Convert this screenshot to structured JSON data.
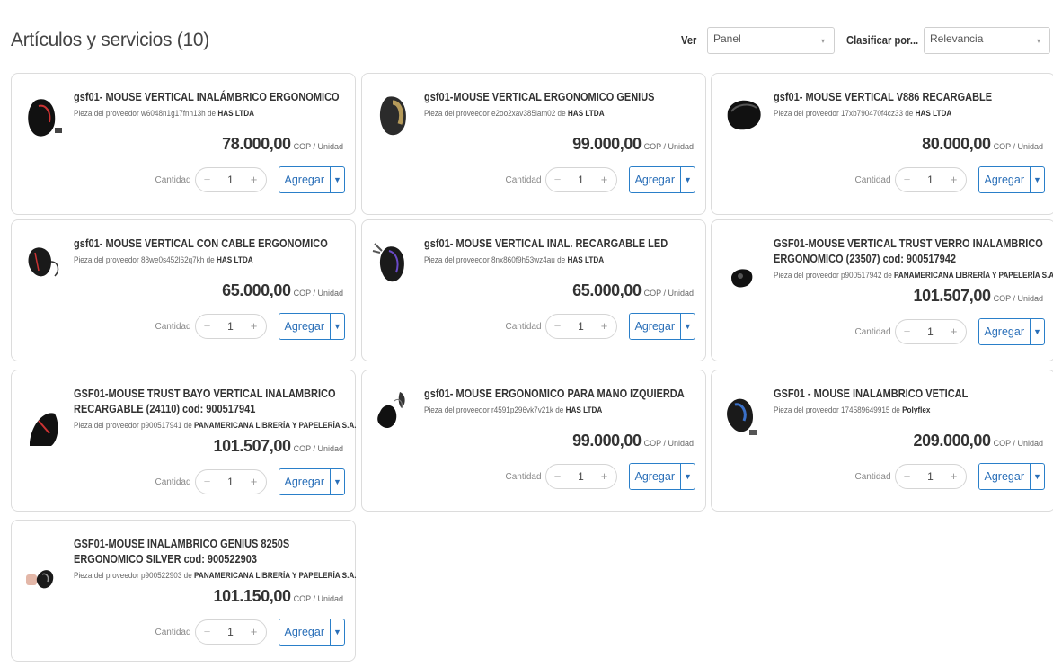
{
  "header": {
    "title": "Artículos y servicios (10)",
    "view_label": "Ver",
    "view_value": "Panel",
    "sort_label": "Clasificar por...",
    "sort_value": "Relevancia"
  },
  "common": {
    "qty_label": "Cantidad",
    "minus": "−",
    "plus": "+",
    "add_label": "Agregar",
    "unit_label": "COP / Unidad",
    "supplier_prefix": "Pieza del proveedor",
    "supplier_joiner": "de"
  },
  "products": [
    {
      "title": "gsf01- MOUSE VERTICAL INALÁMBRICO ERGONOMICO",
      "part": "w6048n1g17fnn13h",
      "supplier": "HAS LTDA",
      "price": "78.000,00",
      "qty": "1"
    },
    {
      "title": "gsf01-MOUSE VERTICAL ERGONOMICO GENIUS",
      "part": "e2oo2xav385lam02",
      "supplier": "HAS LTDA",
      "price": "99.000,00",
      "qty": "1"
    },
    {
      "title": "gsf01- MOUSE VERTICAL V886 RECARGABLE",
      "part": "17xb790470f4cz33",
      "supplier": "HAS LTDA",
      "price": "80.000,00",
      "qty": "1"
    },
    {
      "title": "gsf01- MOUSE VERTICAL CON CABLE ERGONOMICO",
      "part": "88we0s452l62q7kh",
      "supplier": "HAS LTDA",
      "price": "65.000,00",
      "qty": "1"
    },
    {
      "title": "gsf01- MOUSE VERTICAL INAL. RECARGABLE LED",
      "part": "8nx860f9h53wz4au",
      "supplier": "HAS LTDA",
      "price": "65.000,00",
      "qty": "1"
    },
    {
      "title": "GSF01-MOUSE VERTICAL TRUST VERRO INALAMBRICO ERGONOMICO (23507) cod: 900517942",
      "part": "p900517942",
      "supplier": "PANAMERICANA LIBRERÍA Y PAPELERÍA S.A.",
      "price": "101.507,00",
      "qty": "1"
    },
    {
      "title": "GSF01-MOUSE TRUST BAYO VERTICAL INALAMBRICO RECARGABLE (24110) cod: 900517941",
      "part": "p900517941",
      "supplier": "PANAMERICANA LIBRERÍA Y PAPELERÍA S.A.",
      "price": "101.507,00",
      "qty": "1"
    },
    {
      "title": "gsf01- MOUSE ERGONOMICO PARA MANO IZQUIERDA",
      "part": "r4591p296vk7v21k",
      "supplier": "HAS LTDA",
      "price": "99.000,00",
      "qty": "1"
    },
    {
      "title": "GSF01 - MOUSE INALAMBRICO VETICAL",
      "part": "174589649915",
      "supplier": "Polyflex",
      "price": "209.000,00",
      "qty": "1"
    },
    {
      "title": "GSF01-MOUSE INALAMBRICO GENIUS 8250S ERGONOMICO SILVER cod: 900522903",
      "part": "p900522903",
      "supplier": "PANAMERICANA LIBRERÍA Y PAPELERÍA S.A.",
      "price": "101.150,00",
      "qty": "1"
    }
  ],
  "icons": {
    "select_caret": "chevron-down-icon",
    "add_caret": "chevron-down-icon",
    "product_image": "mouse-product-image"
  },
  "colors": {
    "accent": "#2a7fc9",
    "card_border": "#dcdcdc"
  }
}
